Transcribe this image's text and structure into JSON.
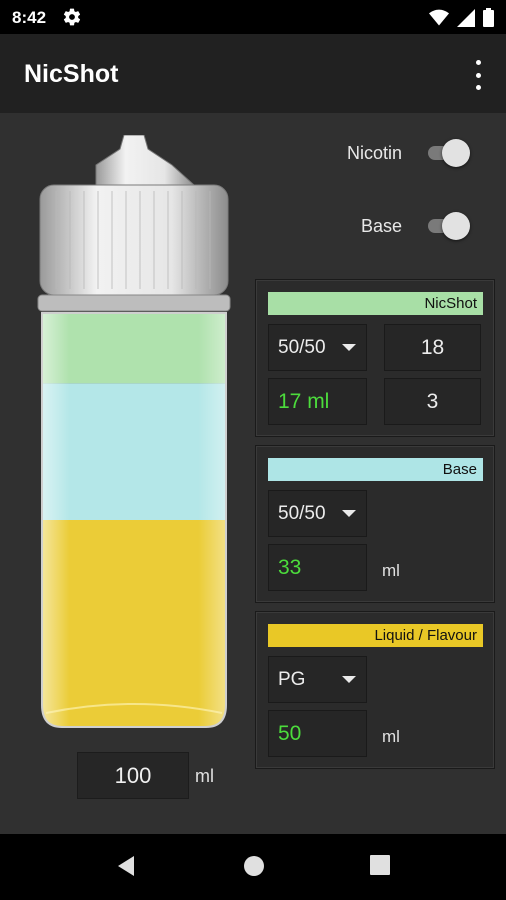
{
  "status": {
    "time": "8:42",
    "icons": [
      "gear-icon",
      "wifi-icon",
      "signal-icon",
      "battery-icon"
    ]
  },
  "app": {
    "title": "NicShot",
    "menu_icon": "more-vert-icon"
  },
  "toggles": {
    "nicotin_label": "Nicotin",
    "nicotin_on": true,
    "base_label": "Base",
    "base_on": true
  },
  "colors": {
    "nicshot": "#a8dfa6",
    "base": "#aee5e6",
    "liquid": "#e9c826",
    "value_green": "#4cdc3c"
  },
  "bottle": {
    "layers": [
      {
        "name": "NicShot",
        "ml": 17
      },
      {
        "name": "Base",
        "ml": 33
      },
      {
        "name": "Liquid / Flavour",
        "ml": 50
      }
    ]
  },
  "total": {
    "value": "100",
    "unit": "ml"
  },
  "panels": {
    "nicshot": {
      "header": "NicShot",
      "ratio": "50/50",
      "strength": "18",
      "amount": "17 ml",
      "target": "3"
    },
    "base": {
      "header": "Base",
      "ratio": "50/50",
      "amount": "33",
      "unit": "ml"
    },
    "liquid": {
      "header": "Liquid / Flavour",
      "ratio": "PG",
      "amount": "50",
      "unit": "ml"
    }
  },
  "nav": {
    "icons": [
      "back-icon",
      "home-icon",
      "recents-icon"
    ]
  }
}
